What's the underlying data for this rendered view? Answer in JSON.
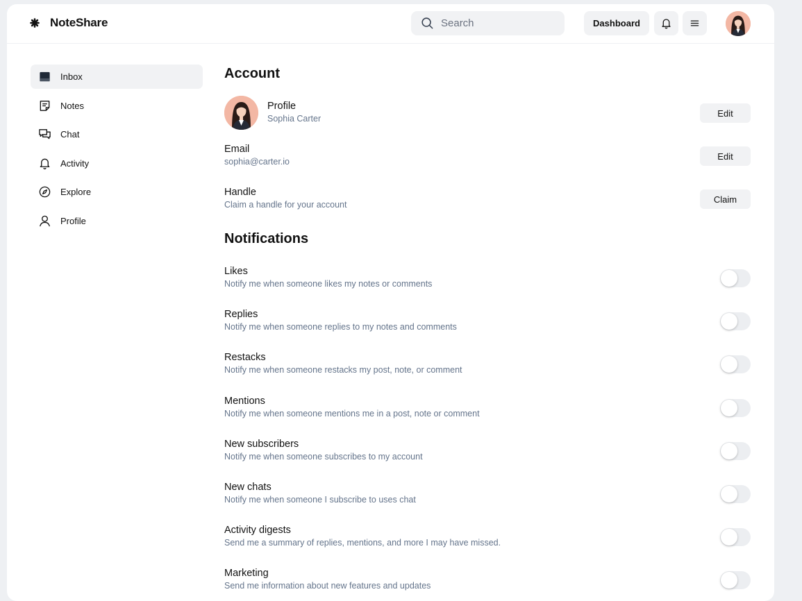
{
  "brand": {
    "name": "NoteShare"
  },
  "header": {
    "search_placeholder": "Search",
    "dashboard_label": "Dashboard",
    "icons": [
      "bell-icon",
      "menu-icon"
    ]
  },
  "sidebar": {
    "items": [
      {
        "label": "Inbox",
        "icon": "inbox-icon",
        "active": true
      },
      {
        "label": "Notes",
        "icon": "notes-icon"
      },
      {
        "label": "Chat",
        "icon": "chat-icon"
      },
      {
        "label": "Activity",
        "icon": "bell-icon"
      },
      {
        "label": "Explore",
        "icon": "compass-icon"
      },
      {
        "label": "Profile",
        "icon": "user-icon"
      }
    ]
  },
  "account": {
    "title": "Account",
    "profile": {
      "title": "Profile",
      "value": "Sophia Carter",
      "action": "Edit"
    },
    "email": {
      "title": "Email",
      "value": "sophia@carter.io",
      "action": "Edit"
    },
    "handle": {
      "title": "Handle",
      "value": "Claim a handle for your account",
      "action": "Claim"
    }
  },
  "notifications": {
    "title": "Notifications",
    "items": [
      {
        "title": "Likes",
        "desc": "Notify me when someone likes my notes or comments",
        "enabled": false
      },
      {
        "title": "Replies",
        "desc": "Notify me when someone replies to my notes and comments",
        "enabled": false
      },
      {
        "title": "Restacks",
        "desc": "Notify me when someone restacks my post, note, or comment",
        "enabled": false
      },
      {
        "title": "Mentions",
        "desc": "Notify me when someone mentions me in a post, note or comment",
        "enabled": false
      },
      {
        "title": "New subscribers",
        "desc": "Notify me when someone subscribes to my account",
        "enabled": false
      },
      {
        "title": "New chats",
        "desc": "Notify me when someone I subscribe to uses chat",
        "enabled": false
      },
      {
        "title": "Activity digests",
        "desc": "Send me a summary of replies, mentions, and more I may have missed.",
        "enabled": false
      },
      {
        "title": "Marketing",
        "desc": "Send me information about new features and updates",
        "enabled": false
      }
    ]
  },
  "colors": {
    "surface": "#f1f2f4",
    "muted_text": "#64748b",
    "background": "#eef0f3"
  }
}
